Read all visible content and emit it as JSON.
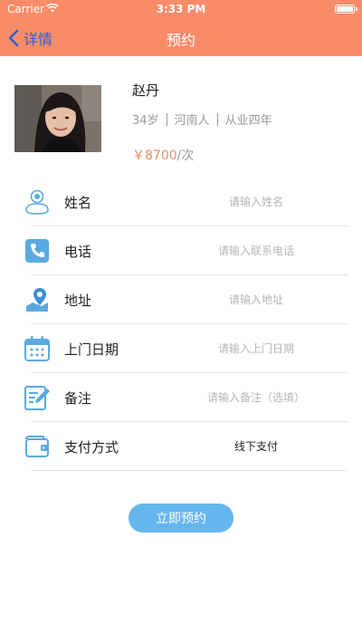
{
  "status_bar": {
    "carrier": "Carrier",
    "time": "3:33 PM"
  },
  "nav": {
    "back_label": "详情",
    "title": "预约"
  },
  "profile": {
    "name": "赵丹",
    "age": "34岁",
    "origin": "河南人",
    "experience": "从业四年",
    "price": "￥8700",
    "price_unit": "/次"
  },
  "form": {
    "rows": [
      {
        "label": "姓名",
        "placeholder": "请输入姓名",
        "icon": "person-icon"
      },
      {
        "label": "电话",
        "placeholder": "请输入联系电话",
        "icon": "phone-icon"
      },
      {
        "label": "地址",
        "placeholder": "请输入地址",
        "icon": "location-icon"
      },
      {
        "label": "上门日期",
        "placeholder": "请输入上门日期",
        "icon": "calendar-icon"
      },
      {
        "label": "备注",
        "placeholder": "请输入备注（选填）",
        "icon": "note-icon"
      },
      {
        "label": "支付方式",
        "value": "线下支付",
        "icon": "wallet-icon"
      }
    ]
  },
  "submit_label": "立即预约",
  "colors": {
    "header": "#fa8b69",
    "accent": "#66b6ee",
    "price": "#f08a63",
    "icon": "#5aa9e0"
  }
}
